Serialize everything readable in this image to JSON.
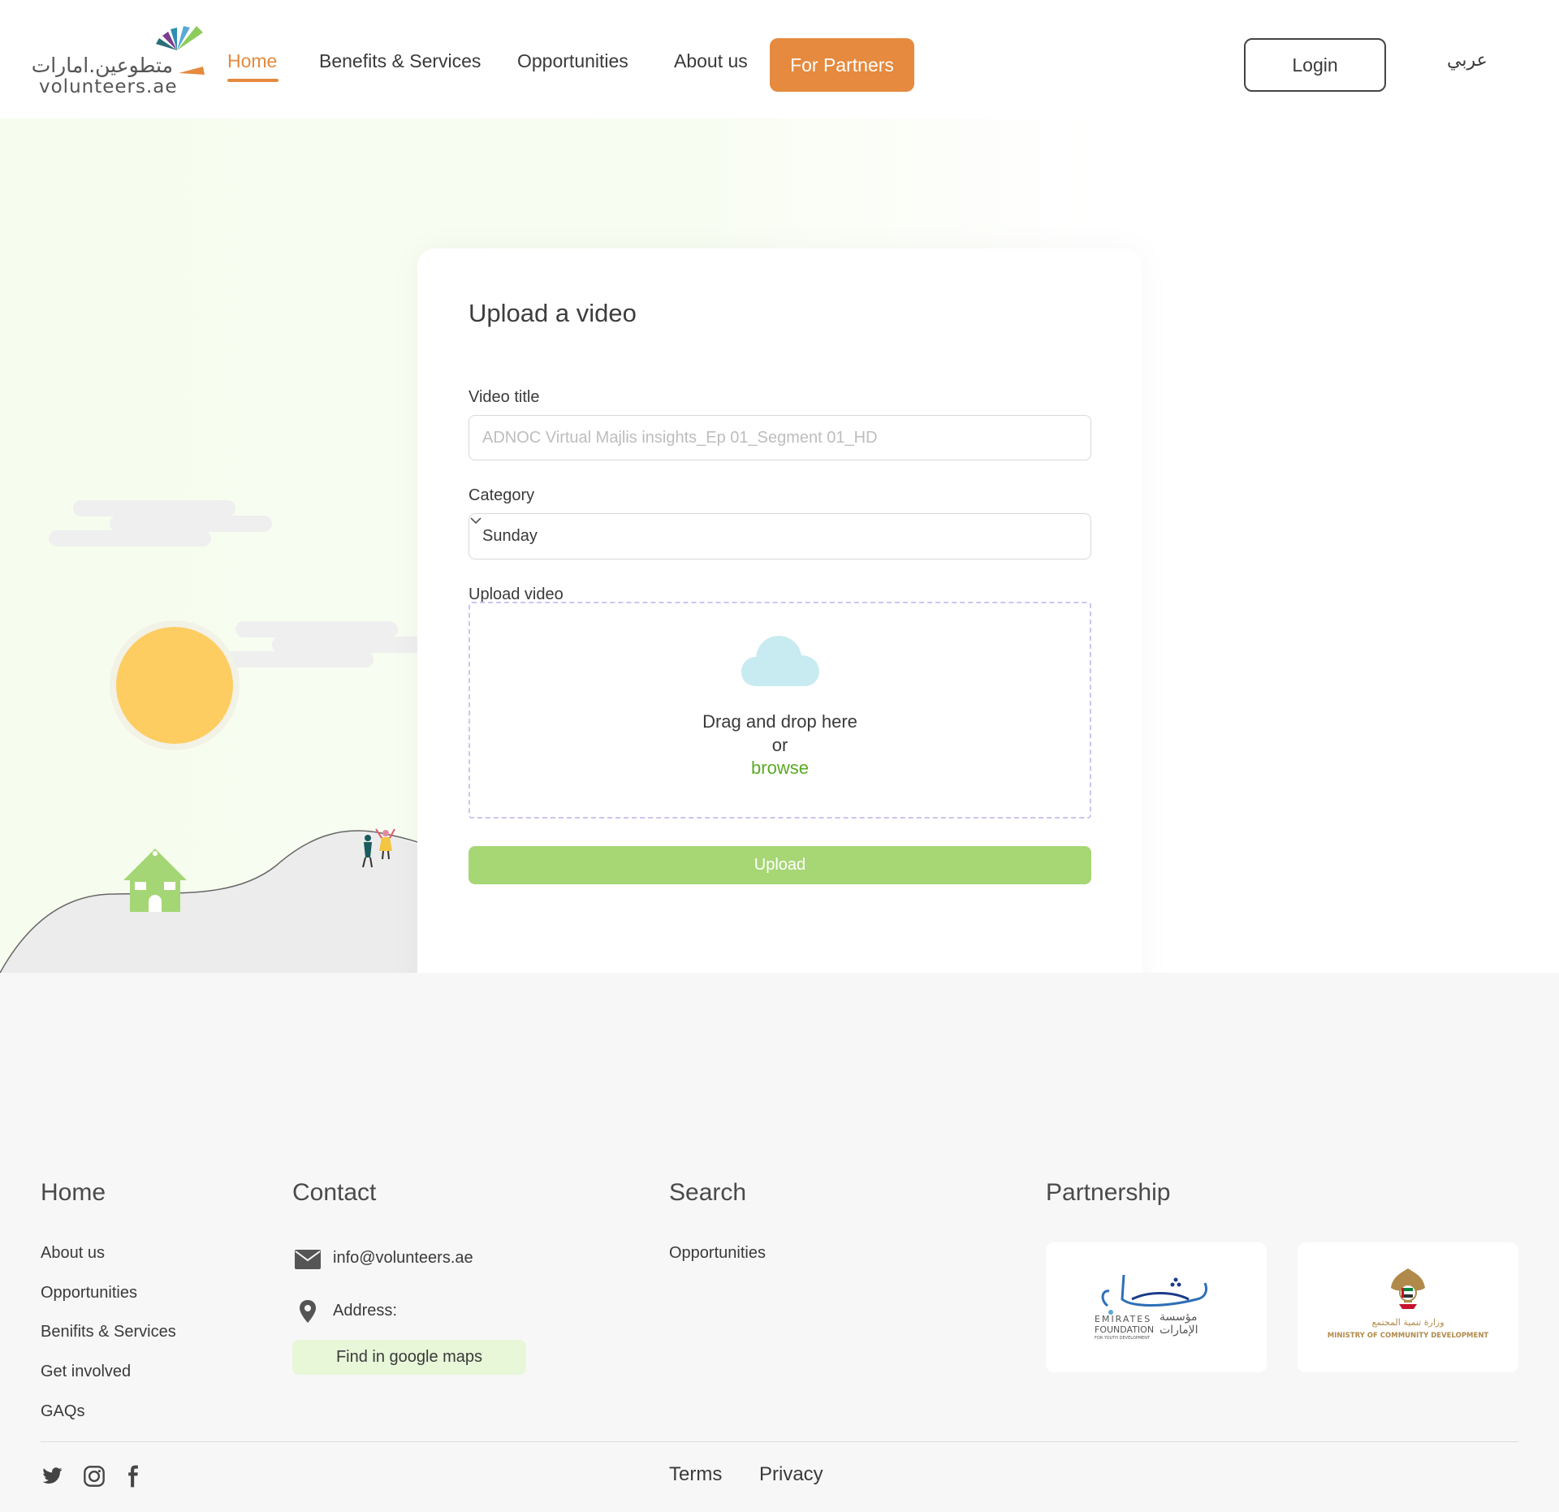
{
  "header": {
    "logo_ar": "متطوعين.امارات",
    "logo_en": "volunteers.ae",
    "nav": {
      "home": "Home",
      "benefits": "Benefits & Services",
      "opportunities": "Opportunities",
      "about": "About us"
    },
    "partners_button": "For Partners",
    "login_button": "Login",
    "language": "عربي"
  },
  "form": {
    "title": "Upload a video",
    "video_title_label": "Video title",
    "video_title_placeholder": "ADNOC Virtual Majlis insights_Ep 01_Segment 01_HD",
    "category_label": "Category",
    "category_value": "Sunday",
    "upload_label": "Upload video",
    "dropzone_text": "Drag and drop here",
    "dropzone_or": "or",
    "dropzone_browse": "browse",
    "upload_button": "Upload"
  },
  "footer": {
    "home": {
      "heading": "Home",
      "links": [
        "About us",
        "Opportunities",
        "Benifits & Services",
        "Get involved",
        "GAQs"
      ]
    },
    "contact": {
      "heading": "Contact",
      "email": "info@volunteers.ae",
      "address_label": "Address:",
      "maps_button": "Find in google maps"
    },
    "search": {
      "heading": "Search",
      "links": [
        "Opportunities"
      ]
    },
    "partnership": {
      "heading": "Partnership",
      "partner1": {
        "en_line1": "EMIRATES",
        "en_line2": "FOUNDATION",
        "en_line3": "FOR YOUTH DEVELOPMENT",
        "ar_line1": "مؤسسة",
        "ar_line2": "الإمارات"
      },
      "partner2": {
        "ar_text": "وزارة تنمية المجتمع",
        "en_text": "MINISTRY OF COMMUNITY DEVELOPMENT"
      }
    },
    "bottom": {
      "terms": "Terms",
      "privacy": "Privacy"
    }
  },
  "colors": {
    "accent_orange": "#e58a3e",
    "accent_green": "#a7d675",
    "browse_green": "#5aaa24",
    "sun": "#fdcd62",
    "house": "#a5d676",
    "cloud_icon": "#c7ebf0"
  },
  "icons": {
    "dropzone": "cloud-icon",
    "category": "chevron-down-icon",
    "email": "envelope-icon",
    "address": "map-pin-icon",
    "social": [
      "twitter-icon",
      "instagram-icon",
      "facebook-icon"
    ]
  }
}
